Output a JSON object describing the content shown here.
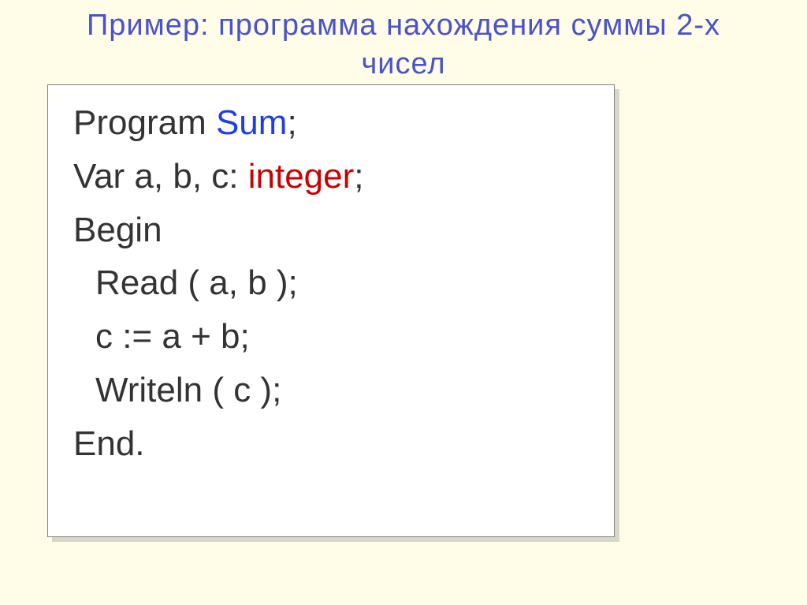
{
  "title_line1": "Пример: программа нахождения суммы 2-х",
  "title_line2": "чисел",
  "code": {
    "l1a": "Program ",
    "l1b": "Sum",
    "l1c": ";",
    "l2a": "Var a, b, c: ",
    "l2b": "integer",
    "l2c": ";",
    "l3": "Begin",
    "l4": "Read ( a, b );",
    "l5": "c := a + b;",
    "l6": "Writeln ( c );",
    "l7": "End."
  }
}
